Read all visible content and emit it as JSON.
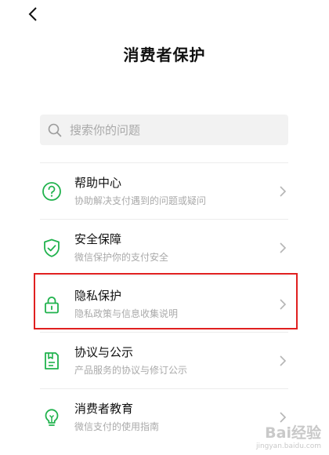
{
  "page": {
    "title": "消费者保护"
  },
  "search": {
    "placeholder": "搜索你的问题"
  },
  "menu": {
    "items": [
      {
        "label": "帮助中心",
        "subtitle": "协助解决支付遇到的问题或疑问",
        "icon": "question-circle-icon"
      },
      {
        "label": "安全保障",
        "subtitle": "微信保护你的支付安全",
        "icon": "shield-check-icon"
      },
      {
        "label": "隐私保护",
        "subtitle": "隐私政策与信息收集说明",
        "icon": "lock-icon",
        "highlighted": true
      },
      {
        "label": "协议与公示",
        "subtitle": "产品服务的协议与修订公示",
        "icon": "bookmark-doc-icon"
      },
      {
        "label": "消费者教育",
        "subtitle": "微信支付的使用指南",
        "icon": "lightbulb-icon"
      }
    ]
  },
  "colors": {
    "accent_green": "#20b24d",
    "highlight_red": "#e02020"
  },
  "watermark": {
    "main": "Bai经验",
    "sub": "jingyan.baidu.com"
  }
}
